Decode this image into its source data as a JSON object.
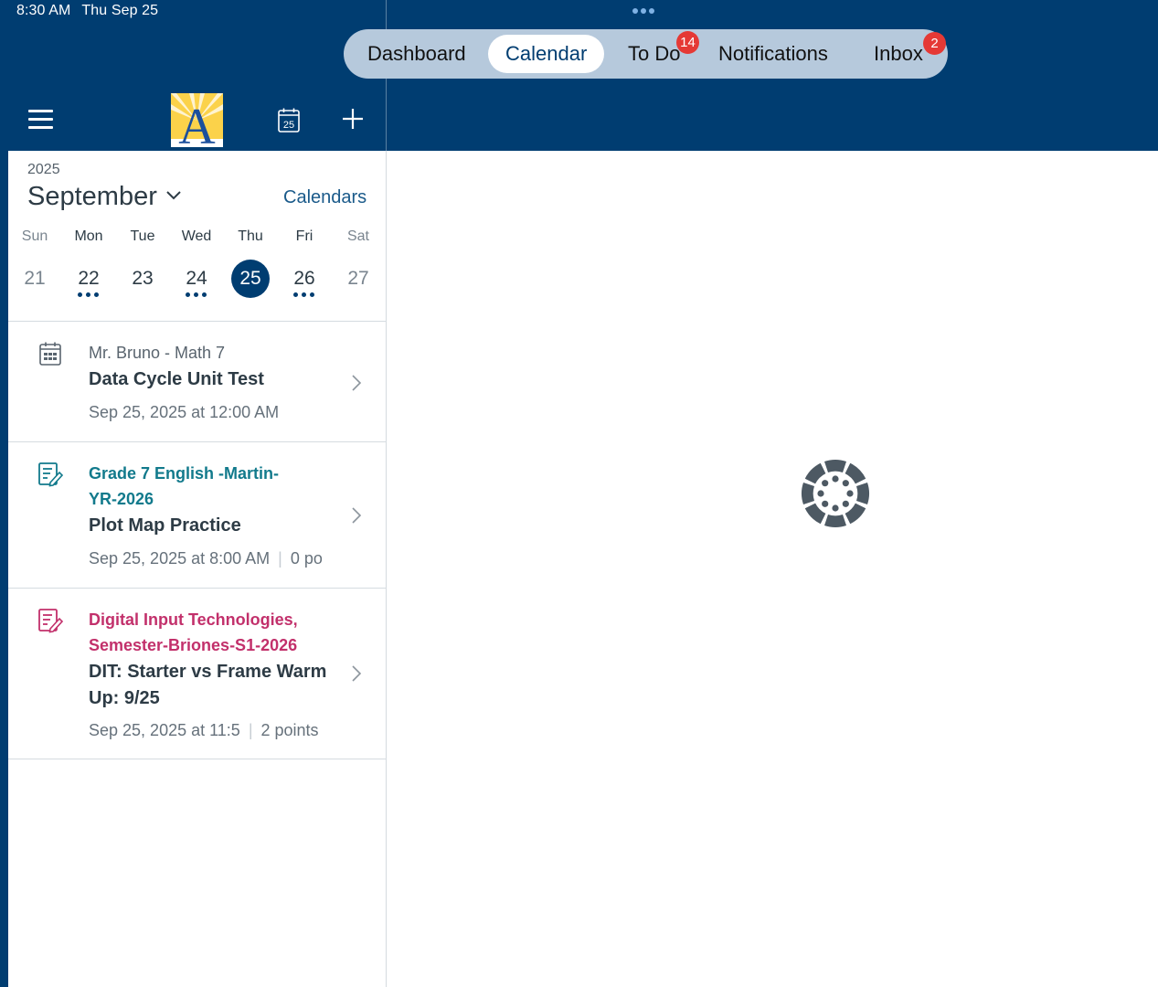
{
  "status_bar": {
    "time": "8:30 AM",
    "date": "Thu Sep 25"
  },
  "tabs": [
    {
      "label": "Dashboard",
      "active": false
    },
    {
      "label": "Calendar",
      "active": true
    },
    {
      "label": "To Do",
      "active": false,
      "badge": "14"
    },
    {
      "label": "Notifications",
      "active": false
    },
    {
      "label": "Inbox",
      "active": false,
      "badge": "2"
    }
  ],
  "header": {
    "logo_letter": "A",
    "calendar_icon_day": "25",
    "icons": [
      "menu-icon",
      "calendar-icon",
      "plus-icon"
    ]
  },
  "calendar": {
    "year": "2025",
    "month": "September",
    "calendars_link": "Calendars",
    "weekdays": [
      "Sun",
      "Mon",
      "Tue",
      "Wed",
      "Thu",
      "Fri",
      "Sat"
    ],
    "days": [
      {
        "num": "21",
        "events": false,
        "selected": false,
        "weekend": true
      },
      {
        "num": "22",
        "events": true,
        "selected": false,
        "weekend": false
      },
      {
        "num": "23",
        "events": false,
        "selected": false,
        "weekend": false
      },
      {
        "num": "24",
        "events": true,
        "selected": false,
        "weekend": false
      },
      {
        "num": "25",
        "events": false,
        "selected": true,
        "weekend": false
      },
      {
        "num": "26",
        "events": true,
        "selected": false,
        "weekend": false
      },
      {
        "num": "27",
        "events": false,
        "selected": false,
        "weekend": true
      }
    ]
  },
  "items": [
    {
      "icon": "calendar-event-icon",
      "course": "Mr. Bruno - Math 7",
      "title": "Data Cycle Unit Test",
      "meta_date": "Sep 25, 2025 at 12:00 AM"
    },
    {
      "icon": "assignment-icon",
      "course_line1": "Grade 7 English -Martin-",
      "course_line2": "YR-2026",
      "title": "Plot Map Practice",
      "meta_date": "Sep 25, 2025 at 8:00 AM",
      "meta_points": "0 po",
      "color": "#127a8c"
    },
    {
      "icon": "assignment-icon",
      "course_line1": "Digital Input Technologies,",
      "course_line2": "Semester-Briones-S1-2026",
      "title_line1": "DIT: Starter vs Frame Warm",
      "title_line2": "Up: 9/25",
      "meta_date": "Sep 25, 2025 at 11:5",
      "meta_points": "2 points",
      "color": "#c2306b"
    }
  ],
  "colors": {
    "brand": "#003d71",
    "tabbar": "#b6c9dc",
    "badge": "#e53935",
    "spinner": "#4d5963"
  }
}
